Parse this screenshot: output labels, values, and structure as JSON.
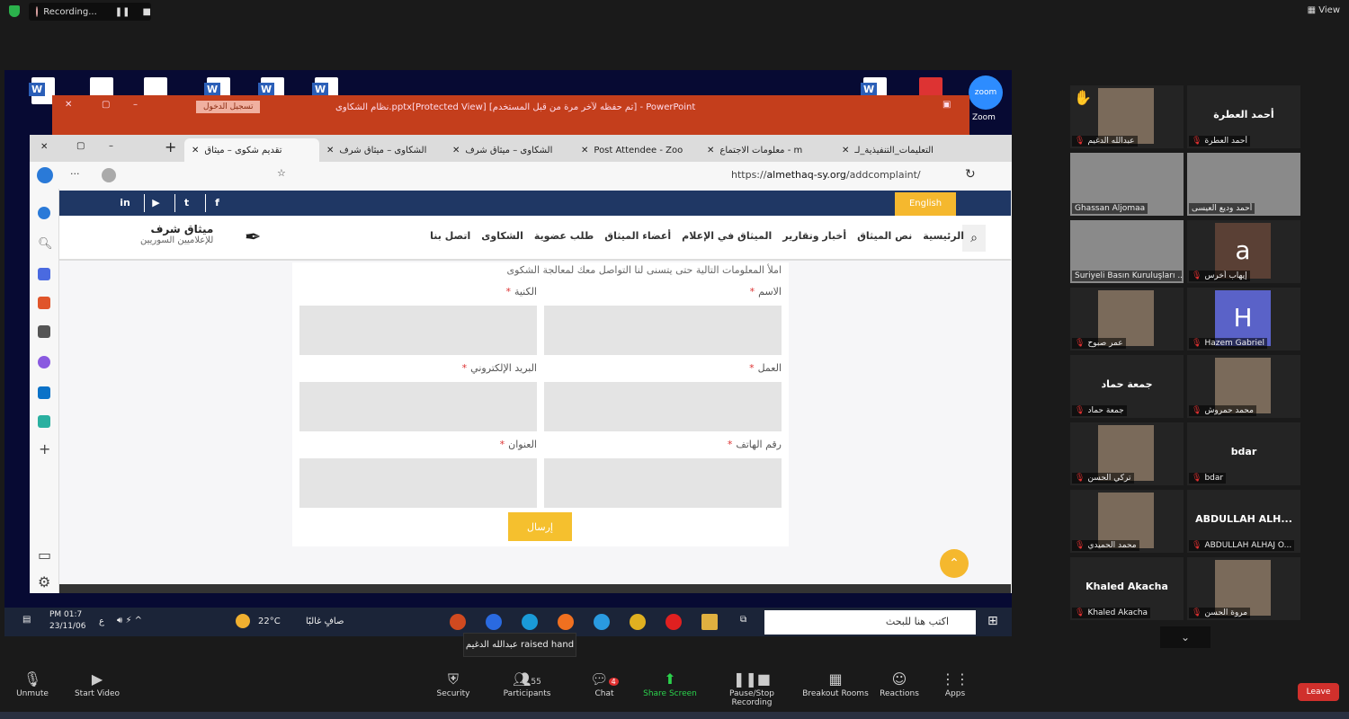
{
  "zoom": {
    "recording_label": "Recording...",
    "view_label": "View",
    "toolbar": [
      {
        "label": "Unmute",
        "icon": "mic-muted-icon"
      },
      {
        "label": "Start Video",
        "icon": "video-off-icon"
      },
      {
        "label": "Security",
        "icon": "shield-icon"
      },
      {
        "label": "Participants",
        "icon": "participants-icon",
        "count": "55"
      },
      {
        "label": "Chat",
        "icon": "chat-icon",
        "badge": "4"
      },
      {
        "label": "Share Screen",
        "icon": "share-screen-icon"
      },
      {
        "label": "Pause/Stop Recording",
        "icon": "pause-stop-icon"
      },
      {
        "label": "Breakout Rooms",
        "icon": "breakout-icon"
      },
      {
        "label": "Reactions",
        "icon": "reactions-icon"
      },
      {
        "label": "Apps",
        "icon": "apps-icon"
      }
    ],
    "leave_label": "Leave",
    "tooltip": "عبدالله الدغيم raised hand",
    "participants": [
      {
        "name": "عبدالله الدغيم",
        "type": "photo",
        "muted": true,
        "hand": true
      },
      {
        "name": "أحمد العطرة",
        "type": "name",
        "display": "أحمد العطرة",
        "muted": true
      },
      {
        "name": "Ghassan Aljomaa",
        "type": "video",
        "muted": false,
        "active": true
      },
      {
        "name": "أحمد وديع العيسى",
        "type": "video",
        "muted": false
      },
      {
        "name": "Suriyeli Basın Kuruluşları ...",
        "type": "video",
        "muted": false
      },
      {
        "name": "إيهاب أخرس",
        "type": "letter",
        "display": "a",
        "color": "#5a4035",
        "muted": true
      },
      {
        "name": "عمر صبوح",
        "type": "photo",
        "muted": true
      },
      {
        "name": "Hazem Gabriel",
        "type": "letter",
        "display": "H",
        "color": "#5a62c8",
        "muted": true
      },
      {
        "name": "جمعة حماد",
        "type": "name",
        "display": "جمعة حماد",
        "muted": true
      },
      {
        "name": "محمد حمروش",
        "type": "photo",
        "muted": true
      },
      {
        "name": "تركي الحسن",
        "type": "photo",
        "muted": true
      },
      {
        "name": "bdar",
        "type": "name",
        "display": "bdar",
        "muted": true
      },
      {
        "name": "محمد الحميدي",
        "type": "photo",
        "muted": true
      },
      {
        "name": "ABDULLAH ALHAJ O...",
        "type": "name",
        "display": "ABDULLAH ALH...",
        "muted": true
      },
      {
        "name": "Khaled Akacha",
        "type": "name",
        "display": "Khaled Akacha",
        "muted": true
      },
      {
        "name": "مروة الحسن",
        "type": "photo",
        "muted": true
      }
    ]
  },
  "powerpoint": {
    "title": "نظام الشكاوى.pptx[Protected View] [تم حفظه لآخر مرة من قبل المستخدم] - PowerPoint",
    "login": "تسجيل الدخول"
  },
  "desktop": {
    "zoom_icon_label": "Zoom"
  },
  "browser": {
    "tabs": [
      {
        "label": "تقديم شكوى – ميثاق",
        "active": true
      },
      {
        "label": "الشكاوى – ميثاق شرف"
      },
      {
        "label": "الشكاوى – ميثاق شرف"
      },
      {
        "label": "Post Attendee - Zoo"
      },
      {
        "label": "معلومات الاجتماع - m"
      },
      {
        "label": "التعليمات_التنفيذية_لـ"
      }
    ],
    "url_domain": "almethaq-sy.org",
    "url_prefix": "https://",
    "url_path": "/addcomplaint/"
  },
  "site": {
    "english": "English",
    "social": [
      "in",
      "▶",
      "t",
      "f"
    ],
    "nav": [
      "الرئيسية",
      "نص الميثاق",
      "أخبار وتقارير",
      "الميثاق في الإعلام",
      "أعضاء الميثاق",
      "طلب عضوية",
      "الشكاوى",
      "اتصل بنا"
    ],
    "logo_title": "ميثاق شرف",
    "logo_subtitle": "للإعلاميين السوريين",
    "form": {
      "intro": "املأ المعلومات التالية حتى يتسنى لنا التواصل معك لمعالجة الشكوى",
      "fields": [
        "الاسم",
        "الكنية",
        "العمل",
        "البريد الإلكتروني",
        "رقم الهاتف",
        "العنوان"
      ],
      "required_mark": "*",
      "submit": "إرسال"
    }
  },
  "taskbar": {
    "time": "PM 01:7",
    "date": "23/11/06",
    "lang": "ع",
    "weather": "22°C",
    "weather_text": "صافٍ غالبًا",
    "search_placeholder": "اكتب هنا للبحث"
  }
}
